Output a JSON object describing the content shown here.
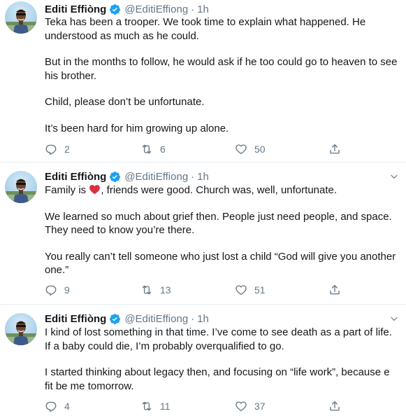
{
  "tweets": [
    {
      "name": "Editi Effiòng",
      "handle": "@EditiEffiong",
      "dot": "·",
      "time": "1h",
      "paragraphs": [
        "Teka has been a trooper. We took time to explain what happened. He understood as much as he could.",
        "But in the months to follow, he would ask if he too could go to heaven to see his brother.",
        "Child, please don’t be unfortunate.",
        "It’s been hard for him growing up alone."
      ],
      "replies": "2",
      "retweets": "6",
      "likes": "50"
    },
    {
      "name": "Editi Effiòng",
      "handle": "@EditiEffiong",
      "dot": "·",
      "time": "1h",
      "family_prefix": "Family is ",
      "heart": "❤️",
      "family_suffix": ", friends were good. Church was, well, unfortunate.",
      "paragraphs": [
        "We learned so much about grief then. People just need people, and space. They need to know you’re there.",
        "You really can’t tell someone who just lost a child “God will give you another one.”"
      ],
      "replies": "9",
      "retweets": "13",
      "likes": "51"
    },
    {
      "name": "Editi Effiòng",
      "handle": "@EditiEffiong",
      "dot": "·",
      "time": "1h",
      "paragraphs": [
        "I kind of lost something in that time. I’ve come to see death as a part of life. If a baby could die, I’m probably overqualified to go.",
        "I started thinking about legacy then, and focusing on “life work”, because e fit be me tomorrow."
      ],
      "replies": "4",
      "retweets": "11",
      "likes": "37"
    }
  ],
  "colors": {
    "text": "#14171a",
    "secondary": "#657786",
    "verified": "#1da1f2",
    "heart_emoji": "#e0245e",
    "divider": "#e6ecf0"
  },
  "icons": [
    "avatar-photo",
    "verified-badge-icon",
    "chevron-down-icon",
    "reply-icon",
    "retweet-icon",
    "like-icon",
    "share-icon"
  ]
}
